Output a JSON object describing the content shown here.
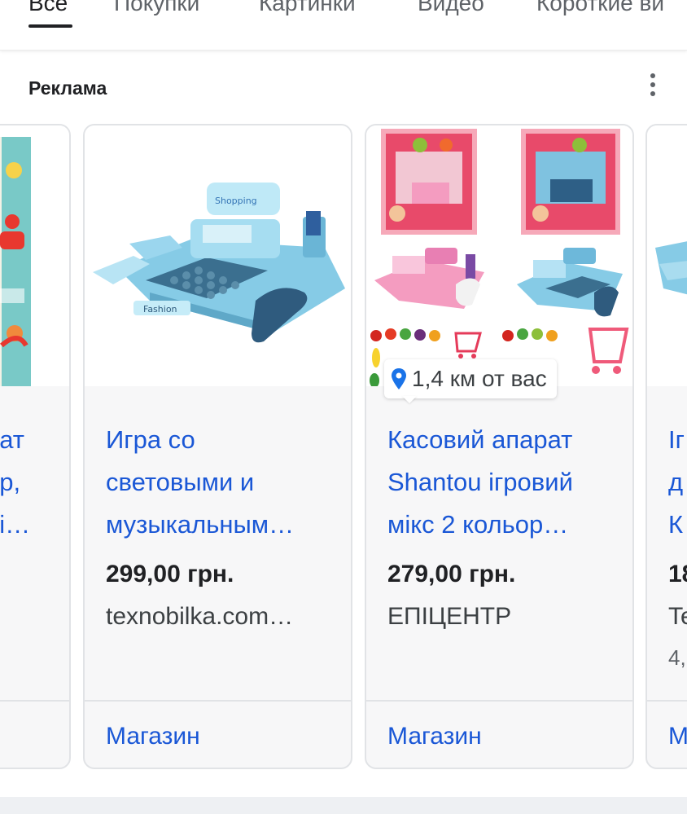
{
  "tabs": [
    {
      "label": "Все",
      "active": true
    },
    {
      "label": "Покупки",
      "active": false
    },
    {
      "label": "Картинки",
      "active": false
    },
    {
      "label": "Видео",
      "active": false
    },
    {
      "label": "Короткие ви",
      "active": false
    }
  ],
  "ads": {
    "label": "Реклама",
    "more_icon": "more-vert-icon"
  },
  "cards": {
    "left_partial": {
      "title_lines": [
        "рат",
        "ер,",
        "рі…"
      ],
      "shop_label": "…"
    },
    "card1": {
      "title_lines": [
        "Игра со",
        "световыми и",
        "музыкальным…"
      ],
      "price": "299,00 грн.",
      "store": "texnobilka.com…",
      "shop_label": "Магазин",
      "image": "toy-cash-register-blue"
    },
    "card2": {
      "title_lines": [
        "Касовий апарат",
        "Shantou ігровий",
        "мікс 2 кольор…"
      ],
      "price": "279,00 грн.",
      "store": "ЕПІЦЕНТР",
      "shop_label": "Магазин",
      "image": "toy-cash-register-pink-and-blue-set",
      "location": "1,4 км от вас"
    },
    "right_partial": {
      "title_lines": [
        "Іг",
        "д",
        "К"
      ],
      "price": "18",
      "store": "Te",
      "rating": "4,",
      "shop_label": "М"
    }
  },
  "colors": {
    "link": "#1a57d6",
    "text": "#202124",
    "card_bg": "#f7f7f8",
    "card_border": "#e1e3e6"
  }
}
